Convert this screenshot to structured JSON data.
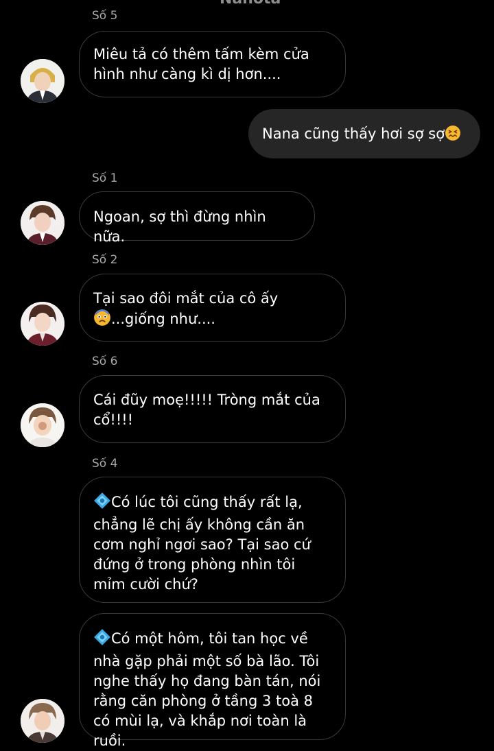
{
  "top_partial_name": "Nanota",
  "messages": [
    {
      "sender": "Số 5",
      "text": "Miêu tả có thêm tấm kèm cửa hình như càng kì dị hơn...."
    },
    {
      "outgoing": true,
      "text": "Nana cũng thấy hơi sợ sợ",
      "emoji": "confounded-face"
    },
    {
      "sender": "Số 1",
      "text": "Ngoan, sợ thì đừng nhìn nữa."
    },
    {
      "sender": "Số 2",
      "text_line1": "Tại sao đôi mắt của cô ấy",
      "emoji": "anxious-face",
      "text_line2": "...giống như...."
    },
    {
      "sender": "Số 6",
      "text": "Cái đũy moẹ!!!!! Tròng mắt của cổ!!!!"
    },
    {
      "sender": "Số 4",
      "emoji": "diamond-dot",
      "text": "Có lúc tôi cũng thấy rất lạ, chẳng lẽ chị ấy không cần ăn cơm nghỉ ngơi sao? Tại sao cứ đứng ở trong phòng nhìn tôi mỉm cười chứ?"
    },
    {
      "emoji": "diamond-dot",
      "text": "Có một hôm, tôi tan học về nhà gặp phải một số bà lão. Tôi nghe thấy họ đang bàn tán, nói rằng căn phòng ở tầng 3 toà 8 có mùi lạ, và khắp nơi toàn là ruồi."
    }
  ],
  "colors": {
    "background": "#000000",
    "incoming_border": "#3a3a3a",
    "outgoing_bubble": "#262626",
    "sender_label": "#a8a8a8"
  }
}
